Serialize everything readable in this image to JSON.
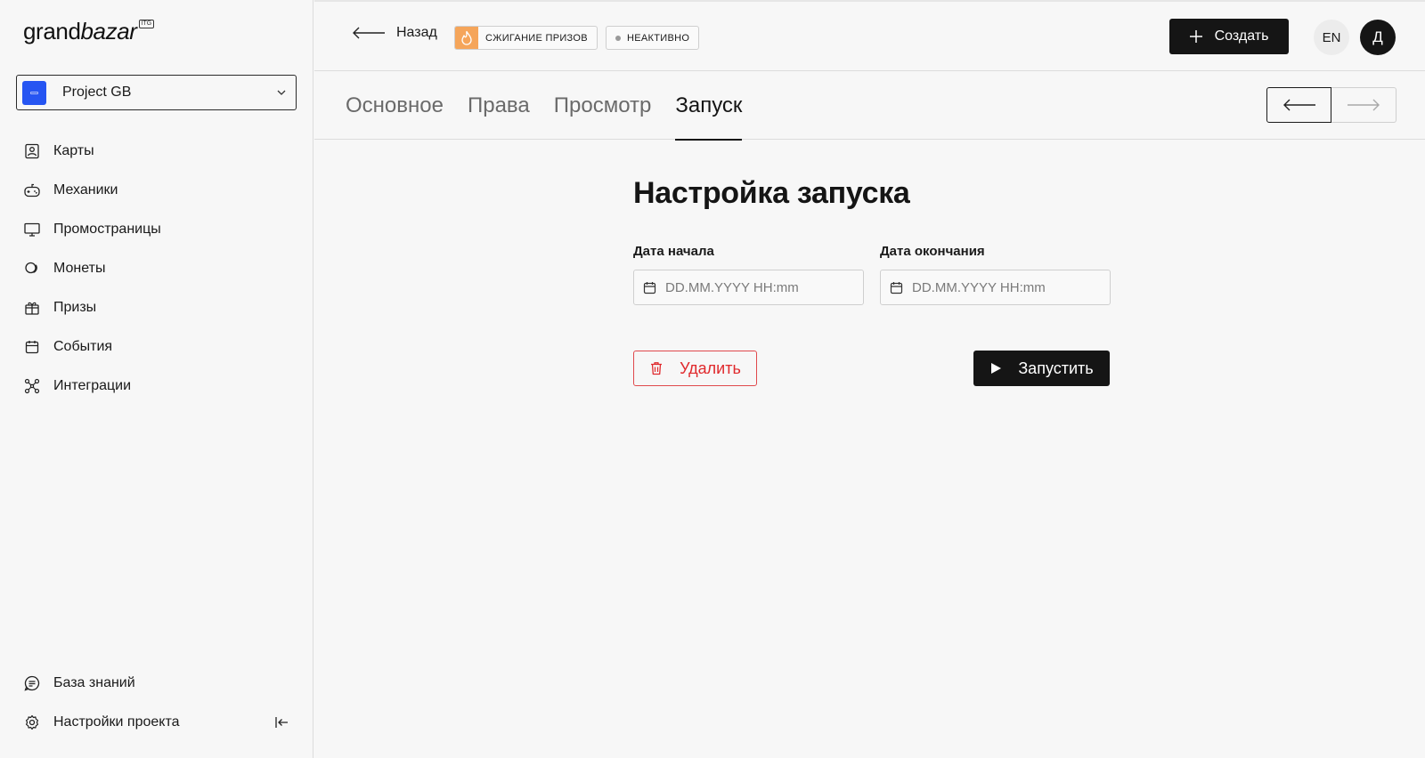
{
  "brand": {
    "logo_text": "grand",
    "logo_italic": "bazar",
    "logo_badge": "ITG"
  },
  "project": {
    "name": "Project GB"
  },
  "sidebar": {
    "items": [
      {
        "label": "Карты",
        "icon": "card-icon"
      },
      {
        "label": "Механики",
        "icon": "gamepad-icon"
      },
      {
        "label": "Промостраницы",
        "icon": "monitor-icon"
      },
      {
        "label": "Монеты",
        "icon": "coins-icon"
      },
      {
        "label": "Призы",
        "icon": "gift-icon"
      },
      {
        "label": "События",
        "icon": "calendar-icon"
      },
      {
        "label": "Интеграции",
        "icon": "integrations-icon"
      }
    ],
    "bottom": [
      {
        "label": "База знаний",
        "icon": "knowledge-icon"
      },
      {
        "label": "Настройки проекта",
        "icon": "settings-icon"
      }
    ]
  },
  "header": {
    "back_label": "Назад",
    "tag_burn": "СЖИГАНИЕ ПРИЗОВ",
    "tag_status": "НЕАКТИВНО",
    "create_label": "Создать",
    "lang": "EN",
    "user_initial": "Д"
  },
  "tabs": [
    {
      "label": "Основное",
      "active": false
    },
    {
      "label": "Права",
      "active": false
    },
    {
      "label": "Просмотр",
      "active": false
    },
    {
      "label": "Запуск",
      "active": true
    }
  ],
  "main": {
    "title": "Настройка запуска",
    "start_date": {
      "label": "Дата начала",
      "placeholder": "DD.MM.YYYY HH:mm",
      "value": ""
    },
    "end_date": {
      "label": "Дата окончания",
      "placeholder": "DD.MM.YYYY HH:mm",
      "value": ""
    },
    "delete_label": "Удалить",
    "launch_label": "Запустить"
  },
  "colors": {
    "accent_dark": "#151515",
    "danger": "#e0292c",
    "burn_tag": "#f5a55a",
    "project_avatar": "#2655f2"
  }
}
